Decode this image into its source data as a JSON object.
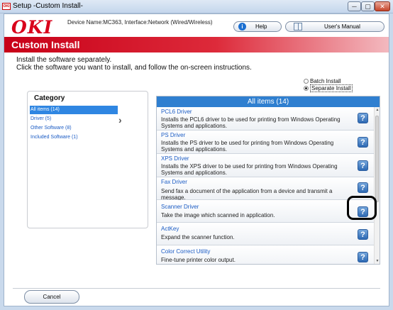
{
  "window": {
    "title": "Setup -Custom Install-",
    "app_icon": "OKI",
    "controls": {
      "minimize": "─",
      "maximize": "▢",
      "close": "✕"
    }
  },
  "header": {
    "logo": "OKI",
    "device_info": "Device Name:MC363, Interface:Network (Wired/Wireless)",
    "help_label": "Help",
    "help_icon": "i",
    "manual_label": "User's Manual"
  },
  "banner": {
    "title": "Custom Install"
  },
  "instructions": {
    "line1": "Install the software separately.",
    "line2": "Click the software you want to install, and follow the on-screen instructions."
  },
  "install_mode": {
    "batch_label": "Batch Install",
    "separate_label": "Separate Install",
    "selected": "separate"
  },
  "category": {
    "title": "Category",
    "items": [
      {
        "label": "All items (14)",
        "selected": true
      },
      {
        "label": "Driver (5)",
        "selected": false
      },
      {
        "label": "Other Software (8)",
        "selected": false
      },
      {
        "label": "Included Software (1)",
        "selected": false
      }
    ],
    "arrow": "›"
  },
  "list": {
    "title": "All items (14)",
    "help_glyph": "?",
    "items": [
      {
        "name": "PCL6 Driver",
        "desc": "Installs the PCL6 driver to be used for printing from Windows Operating Systems and applications."
      },
      {
        "name": "PS Driver",
        "desc": "Installs the PS driver to be used for printing from Windows Operating Systems and applications."
      },
      {
        "name": "XPS Driver",
        "desc": "Installs the XPS driver to be used for printing from Windows Operating Systems and applications."
      },
      {
        "name": "Fax Driver",
        "desc": "Send fax a document of the application from a device and transmit a message."
      },
      {
        "name": "Scanner Driver",
        "desc": "Take the image which scanned in application."
      },
      {
        "name": "ActKey",
        "desc": "Expand the scanner function."
      },
      {
        "name": "Color Correct Utility",
        "desc": "Fine-tune printer color output."
      }
    ],
    "scroll_up": "▲",
    "scroll_down": "▼"
  },
  "footer": {
    "cancel_label": "Cancel"
  }
}
